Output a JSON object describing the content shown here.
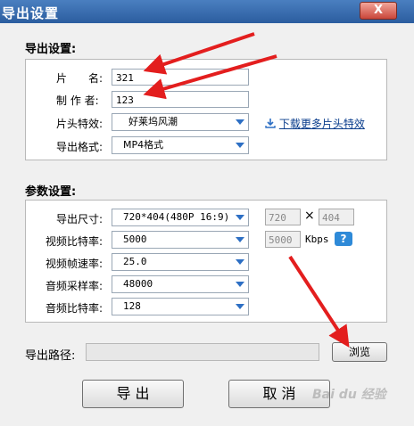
{
  "window": {
    "title": "导出设置",
    "close_label": "X"
  },
  "export_settings": {
    "section_title": "导出设置:",
    "name_label": "片　　名:",
    "name_value": "321",
    "author_label": "制 作 者:",
    "author_value": "123",
    "intro_effect_label": "片头特效:",
    "intro_effect_value": "好莱坞风潮",
    "download_more_label": "下载更多片头特效",
    "format_label": "导出格式:",
    "format_value": "MP4格式"
  },
  "param_settings": {
    "section_title": "参数设置:",
    "size_label": "导出尺寸:",
    "size_value": "720*404(480P 16:9)",
    "width_value": "720",
    "times_sign": "×",
    "height_value": "404",
    "video_bitrate_label": "视频比特率:",
    "video_bitrate_value": "5000",
    "video_bitrate_field": "5000",
    "kbps_label": "Kbps",
    "help_label": "?",
    "frame_rate_label": "视频帧速率:",
    "frame_rate_value": "25.0",
    "sample_rate_label": "音频采样率:",
    "sample_rate_value": "48000",
    "audio_bitrate_label": "音频比特率:",
    "audio_bitrate_value": "128"
  },
  "path": {
    "label": "导出路径:",
    "value": "",
    "browse_label": "浏览"
  },
  "buttons": {
    "export_label": "导 出",
    "cancel_label": "取 消"
  },
  "watermark": "Bai du 经验",
  "colors": {
    "titlebar": "#2b5d9f",
    "annotation_arrow": "#e31e1e",
    "select_arrow": "#2d6fc4"
  }
}
